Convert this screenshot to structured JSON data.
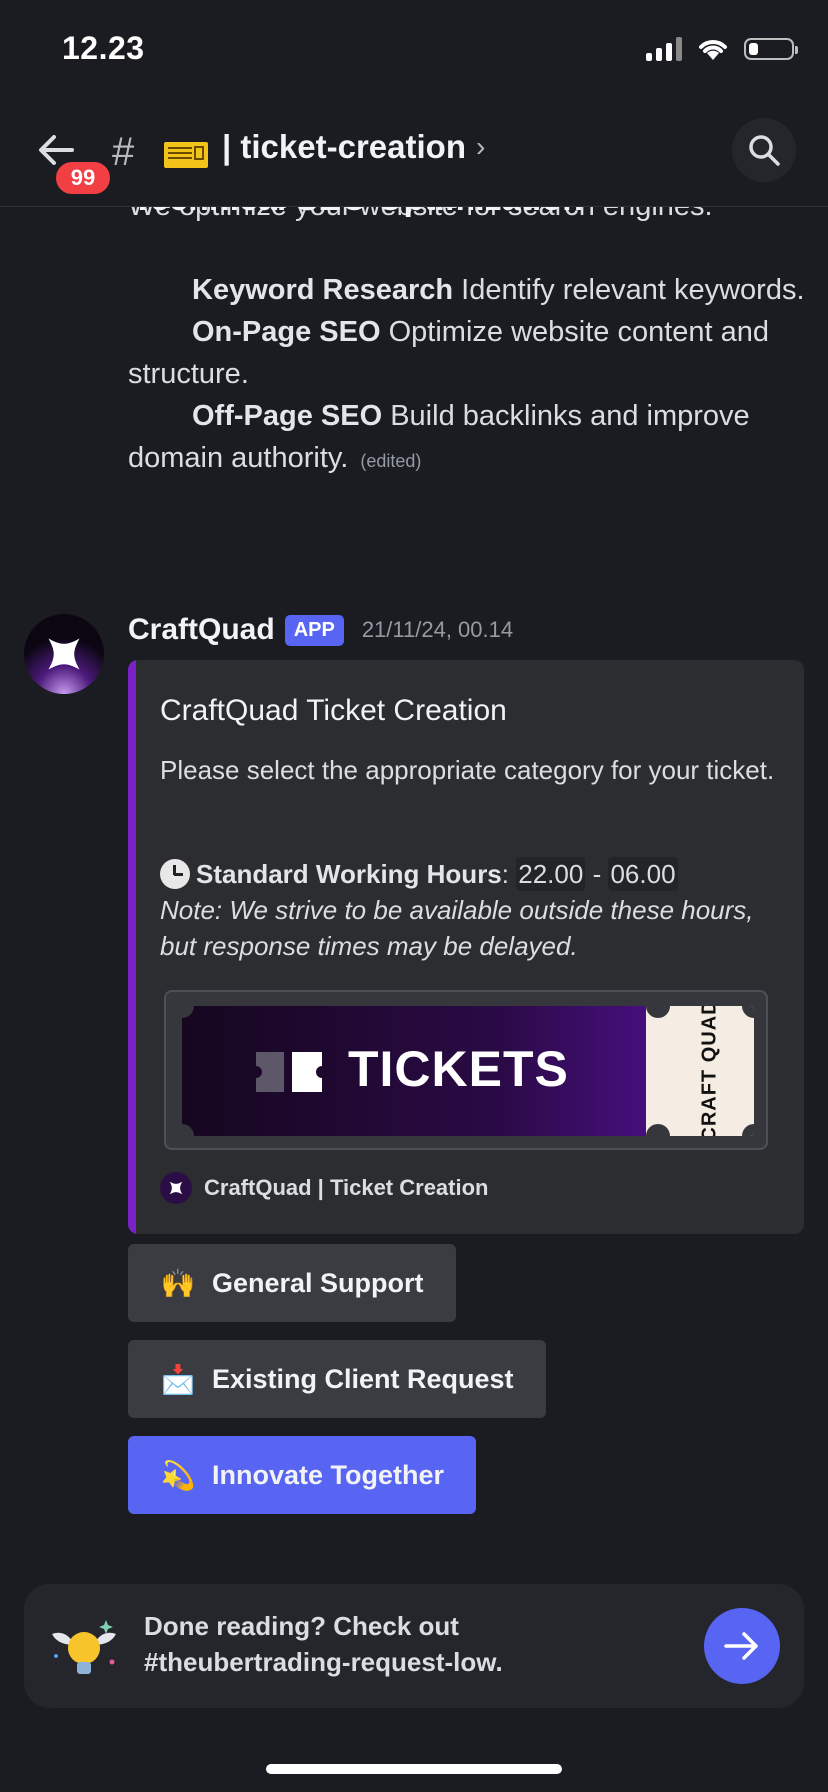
{
  "status_bar": {
    "time": "12.23"
  },
  "header": {
    "unread_badge": "99",
    "hash": "#",
    "channel_name": "| ticket-creation",
    "chevron": "›"
  },
  "previous_message": {
    "clipped_heading": "Technical SEO Optimization",
    "intro": "We optimize your website for search engines.",
    "items": [
      {
        "title": "Keyword Research",
        "text": " Identify relevant keywords."
      },
      {
        "title": "On-Page SEO",
        "text": " Optimize website content and structure."
      },
      {
        "title": "Off-Page SEO",
        "text": " Build backlinks and improve domain authority."
      }
    ],
    "edited": "(edited)"
  },
  "message": {
    "author": "CraftQuad",
    "tag": "APP",
    "timestamp": "21/11/24, 00.14",
    "embed": {
      "title": "CraftQuad Ticket Creation",
      "description": "Please select the appropriate category for your ticket.",
      "hours_label": "Standard Working Hours",
      "hours_sep": ":",
      "hours_start": "22.00",
      "hours_dash": "-",
      "hours_end": "06.00",
      "note": "Note: We strive to be available outside these hours, but response times may be delayed.",
      "banner_text": "TICKETS",
      "banner_stub_text": "CRAFT QUAD",
      "footer": "CraftQuad | Ticket Creation",
      "accent_color": "#7a22c8"
    },
    "buttons": [
      {
        "emoji": "🙌",
        "label": "General Support"
      },
      {
        "emoji": "📩",
        "label": "Existing Client Request"
      },
      {
        "emoji": "💫",
        "label": "Innovate Together"
      }
    ]
  },
  "next_channel": {
    "line1": "Done reading? Check out",
    "line2": "#theubertrading-request-low."
  },
  "colors": {
    "background": "#1b1c21",
    "brand": "#5865f2",
    "badge": "#f23f43"
  }
}
